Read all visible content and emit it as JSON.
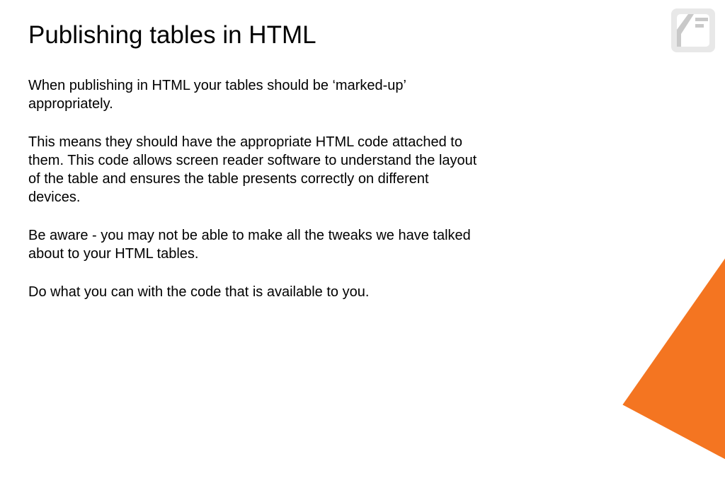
{
  "slide": {
    "title": "Publishing tables in HTML",
    "paragraphs": [
      "When publishing in HTML your tables should be ‘marked-up’ appropriately.",
      "This means they should have the appropriate HTML code attached to them. This code allows screen reader software to understand the layout of the table and ensures the table presents correctly on different devices.",
      "Be aware - you may not be able to make all the tweaks we have talked about to your HTML tables.",
      "Do what you can with the code that is available to you."
    ]
  },
  "theme": {
    "accent": "#f47521"
  }
}
